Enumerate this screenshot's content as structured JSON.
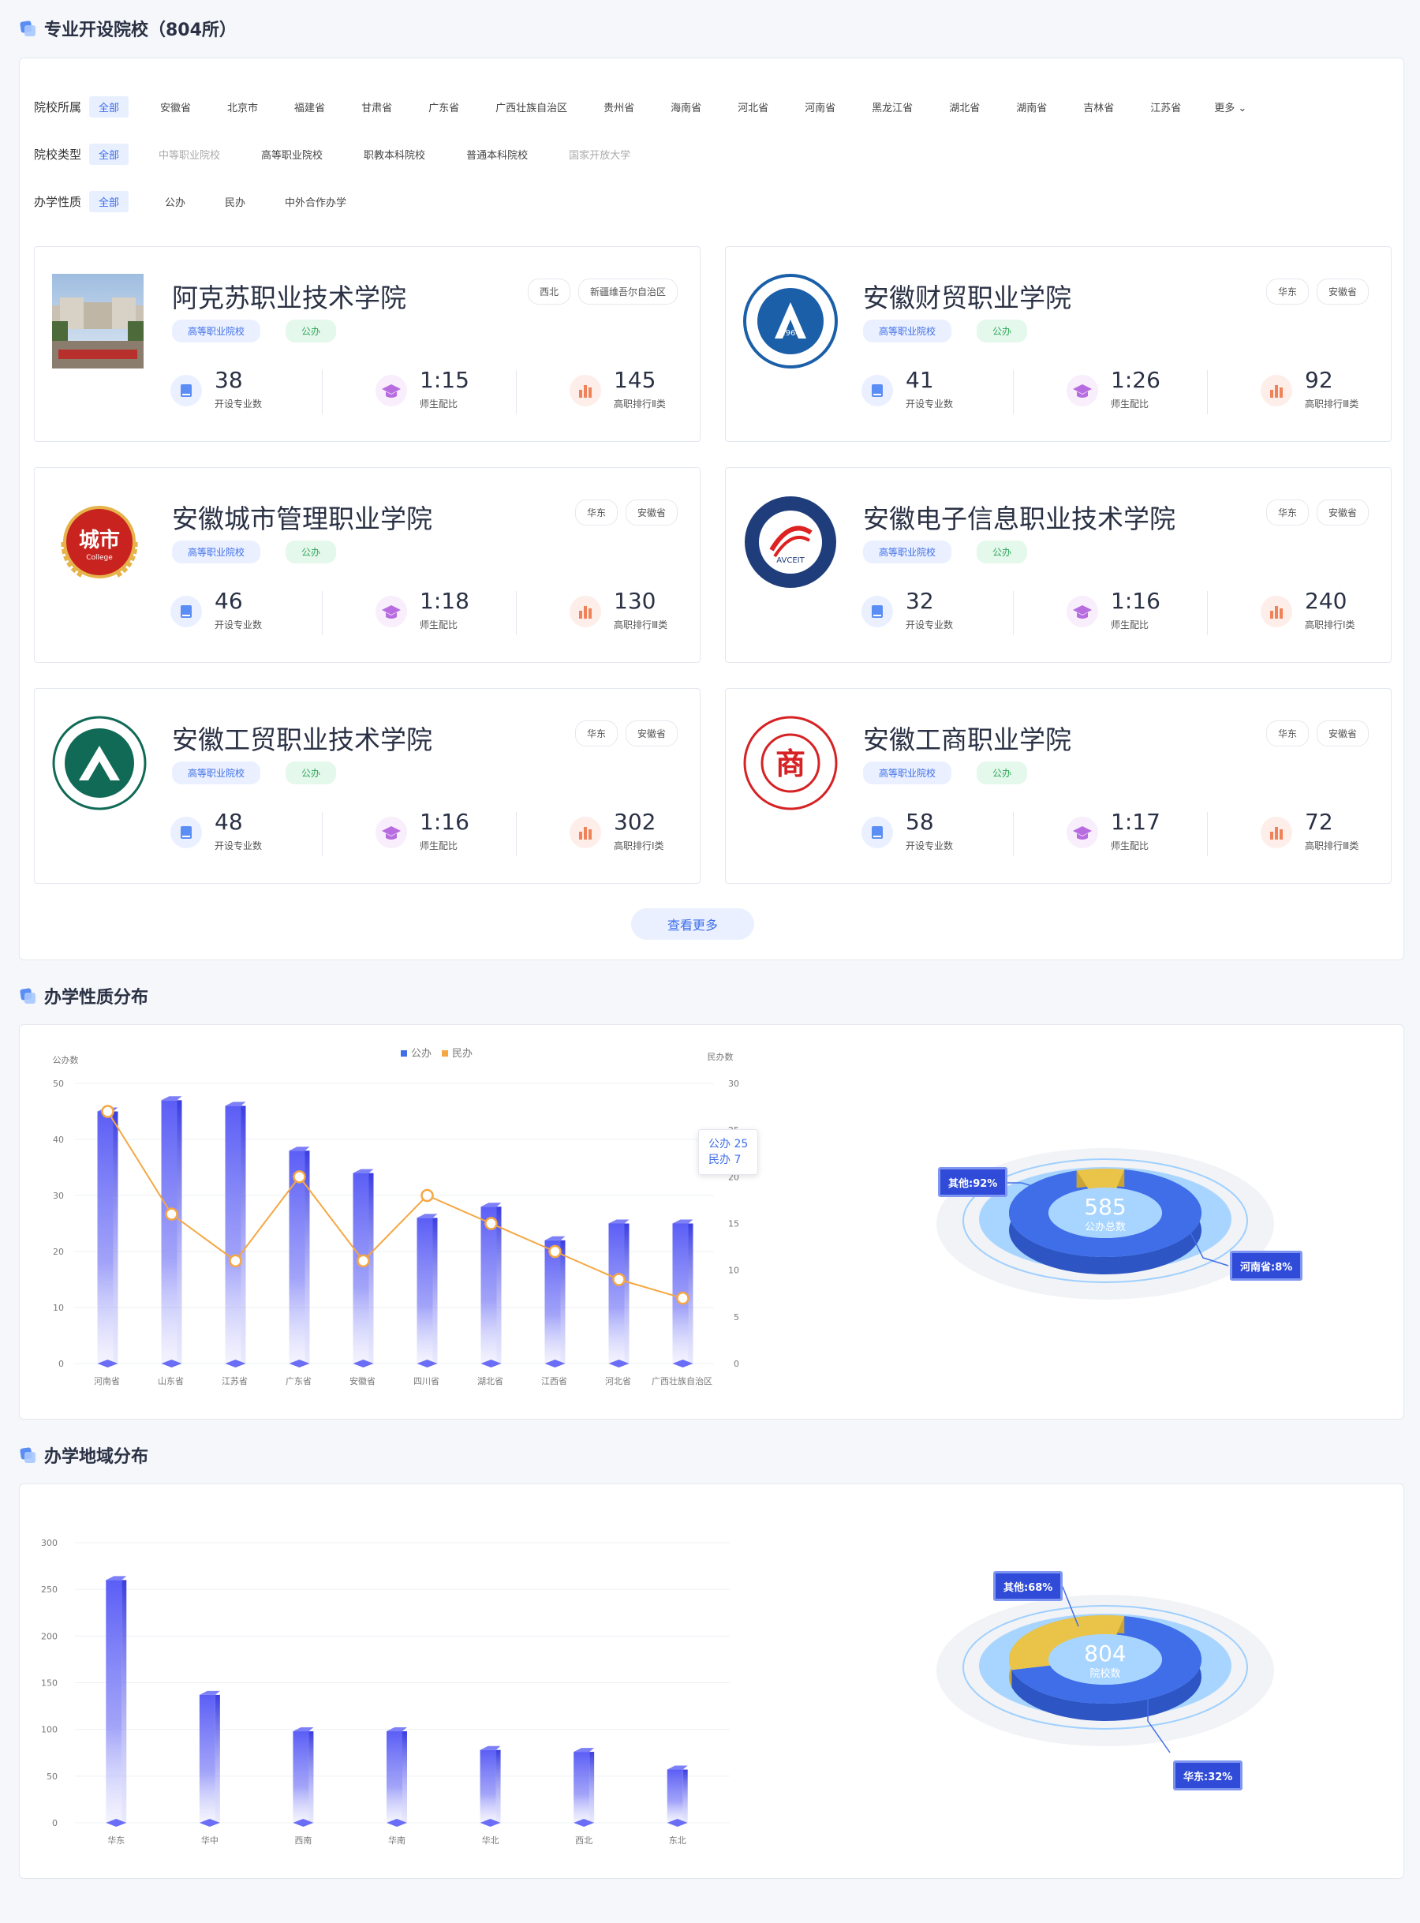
{
  "section1": {
    "title": "专业开设院校（804所）"
  },
  "filters": {
    "region": {
      "label": "院校所属",
      "options": [
        "全部",
        "安徽省",
        "北京市",
        "福建省",
        "甘肃省",
        "广东省",
        "广西壮族自治区",
        "贵州省",
        "海南省",
        "河北省",
        "河南省",
        "黑龙江省",
        "湖北省",
        "湖南省",
        "吉林省",
        "江苏省"
      ],
      "more": "更多"
    },
    "type": {
      "label": "院校类型",
      "options": [
        "全部",
        "中等职业院校",
        "高等职业院校",
        "职教本科院校",
        "普通本科院校",
        "国家开放大学"
      ]
    },
    "nature": {
      "label": "办学性质",
      "options": [
        "全部",
        "公办",
        "民办",
        "中外合作办学"
      ]
    }
  },
  "cards": [
    {
      "name": "阿克苏职业技术学院",
      "tags": [
        "西北",
        "新疆维吾尔自治区"
      ],
      "type": "高等职业院校",
      "nature": "公办",
      "majors": "38",
      "majors_label": "开设专业数",
      "ratio": "1:15",
      "ratio_label": "师生配比",
      "rank": "145",
      "rank_label": "高职排行Ⅱ类",
      "logo": "photo"
    },
    {
      "name": "安徽财贸职业学院",
      "tags": [
        "华东",
        "安徽省"
      ],
      "type": "高等职业院校",
      "nature": "公办",
      "majors": "41",
      "majors_label": "开设专业数",
      "ratio": "1:26",
      "ratio_label": "师生配比",
      "rank": "92",
      "rank_label": "高职排行Ⅲ类",
      "logo": "blue-seal",
      "logo_text": "1964"
    },
    {
      "name": "安徽城市管理职业学院",
      "tags": [
        "华东",
        "安徽省"
      ],
      "type": "高等职业院校",
      "nature": "公办",
      "majors": "46",
      "majors_label": "开设专业数",
      "ratio": "1:18",
      "ratio_label": "师生配比",
      "rank": "130",
      "rank_label": "高职排行Ⅲ类",
      "logo": "red-wreath",
      "logo_text": "城市",
      "logo_sub": "College"
    },
    {
      "name": "安徽电子信息职业技术学院",
      "tags": [
        "华东",
        "安徽省"
      ],
      "type": "高等职业院校",
      "nature": "公办",
      "majors": "32",
      "majors_label": "开设专业数",
      "ratio": "1:16",
      "ratio_label": "师生配比",
      "rank": "240",
      "rank_label": "高职排行Ⅰ类",
      "logo": "navy-seal",
      "logo_text": "AVCEIT"
    },
    {
      "name": "安徽工贸职业技术学院",
      "tags": [
        "华东",
        "安徽省"
      ],
      "type": "高等职业院校",
      "nature": "公办",
      "majors": "48",
      "majors_label": "开设专业数",
      "ratio": "1:16",
      "ratio_label": "师生配比",
      "rank": "302",
      "rank_label": "高职排行Ⅰ类",
      "logo": "green-seal"
    },
    {
      "name": "安徽工商职业学院",
      "tags": [
        "华东",
        "安徽省"
      ],
      "type": "高等职业院校",
      "nature": "公办",
      "majors": "58",
      "majors_label": "开设专业数",
      "ratio": "1:17",
      "ratio_label": "师生配比",
      "rank": "72",
      "rank_label": "高职排行Ⅲ类",
      "logo": "red-seal",
      "logo_text": "商"
    }
  ],
  "more_button": "查看更多",
  "section2": {
    "title": "办学性质分布"
  },
  "section3": {
    "title": "办学地域分布"
  },
  "colors": {
    "primary": "#3f6ee8",
    "bar": "#5b5ef5",
    "line": "#f5a742",
    "donut_blue": "#4a74e8",
    "donut_yellow": "#e9c449"
  },
  "chart_data": [
    {
      "type": "bar",
      "categories": [
        "河南省",
        "山东省",
        "江苏省",
        "广东省",
        "安徽省",
        "四川省",
        "湖北省",
        "江西省",
        "河北省",
        "广西壮族自治区"
      ],
      "series": [
        {
          "name": "公办",
          "type": "bar",
          "axis": "left",
          "values": [
            45,
            47,
            46,
            38,
            34,
            26,
            28,
            22,
            25,
            25
          ]
        },
        {
          "name": "民办",
          "type": "line",
          "axis": "right",
          "values": [
            27,
            16,
            11,
            20,
            11,
            18,
            15,
            12,
            9,
            7
          ]
        }
      ],
      "ylabel_left": "公办数",
      "ylim_left": [
        0,
        50
      ],
      "yticks_left": [
        0,
        10,
        20,
        30,
        40,
        50
      ],
      "ylabel_right": "民办数",
      "ylim_right": [
        0,
        30
      ],
      "yticks_right": [
        0,
        5,
        10,
        15,
        20,
        25,
        30
      ],
      "legend": "top-center",
      "tooltip": {
        "line1": "公办 25",
        "line2": "民办 7"
      }
    },
    {
      "type": "pie",
      "center_value": "585",
      "center_label": "公办总数",
      "slices": [
        {
          "label": "其他:92%",
          "value": 92
        },
        {
          "label": "河南省:8%",
          "value": 8
        }
      ]
    },
    {
      "type": "bar",
      "categories": [
        "华东",
        "华中",
        "西南",
        "华南",
        "华北",
        "西北",
        "东北"
      ],
      "values": [
        260,
        137,
        98,
        98,
        78,
        76,
        57
      ],
      "ylim": [
        0,
        300
      ],
      "yticks": [
        0,
        50,
        100,
        150,
        200,
        250,
        300
      ]
    },
    {
      "type": "pie",
      "center_value": "804",
      "center_label": "院校数",
      "slices": [
        {
          "label": "其他:68%",
          "value": 68
        },
        {
          "label": "华东:32%",
          "value": 32
        }
      ]
    }
  ]
}
